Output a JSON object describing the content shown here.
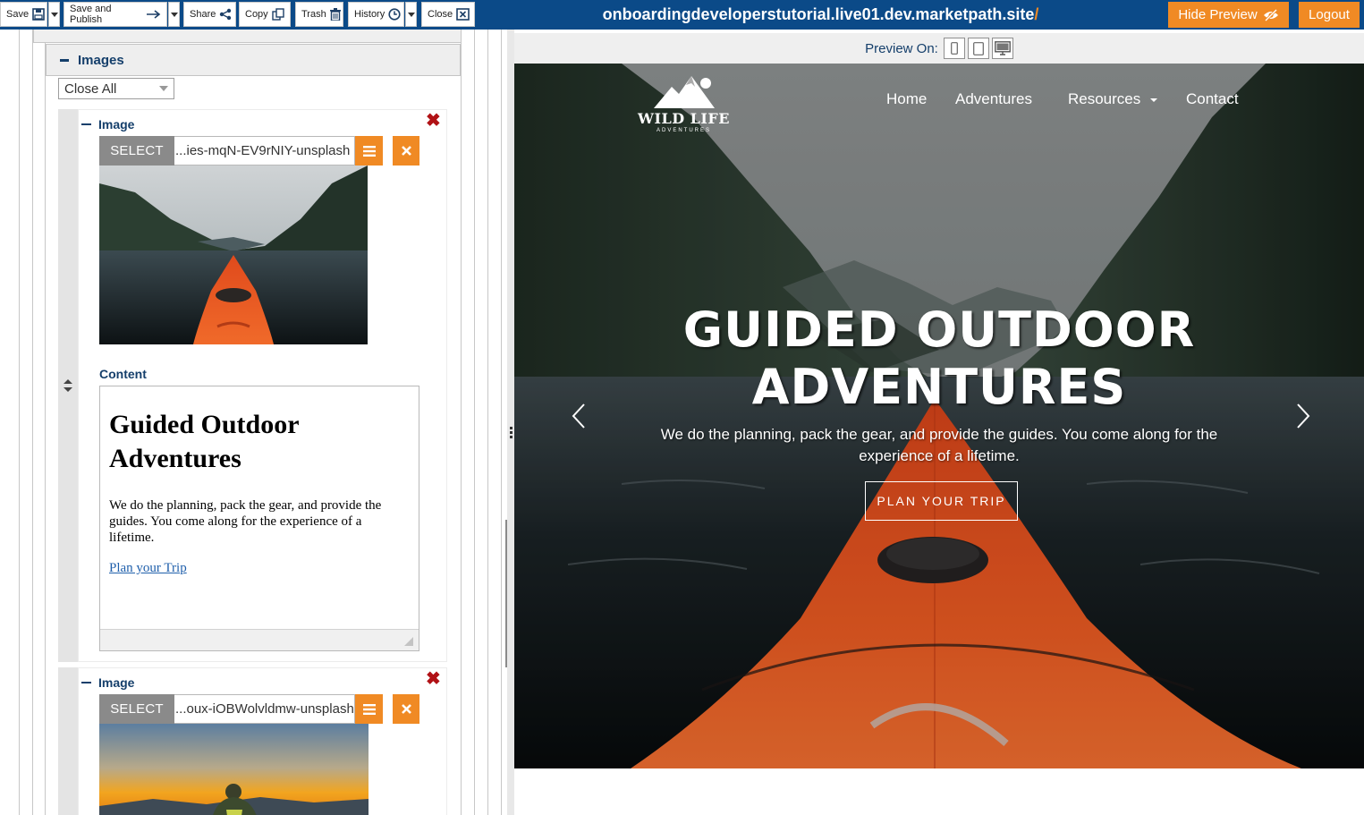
{
  "toolbar": {
    "save": "Save",
    "save_publish": "Save and Publish",
    "share": "Share",
    "copy": "Copy",
    "trash": "Trash",
    "history": "History",
    "close": "Close",
    "site_url": "onboardingdeveloperstutorial.live01.dev.marketpath.site",
    "site_url_slash": "/",
    "hide_preview": "Hide Preview",
    "logout": "Logout"
  },
  "editor": {
    "section_title": "Images",
    "close_all": "Close All",
    "items": [
      {
        "header": "Image",
        "select_label": "SELECT",
        "filename": "...ies-mqN-EV9rNIY-unsplash",
        "content_label": "Content",
        "content": {
          "heading": "Guided Outdoor Adventures",
          "paragraph": "We do the planning, pack the gear, and provide the guides. You come along for the experience of a lifetime.",
          "link": "Plan your Trip"
        }
      },
      {
        "header": "Image",
        "select_label": "SELECT",
        "filename": "...oux-iOBWolvldmw-unsplash"
      }
    ]
  },
  "preview": {
    "label": "Preview On:",
    "devices": [
      "phone-icon",
      "tablet-icon",
      "desktop-icon"
    ],
    "site": {
      "logo_title": "WILD LIFE",
      "logo_sub": "ADVENTURES",
      "nav": [
        "Home",
        "Adventures",
        "Resources",
        "Contact"
      ],
      "hero_title_1": "GUIDED OUTDOOR",
      "hero_title_2": "ADVENTURES",
      "hero_sub": "We do the planning, pack the gear, and provide the guides. You come along for the experience of a lifetime.",
      "cta": "PLAN YOUR TRIP"
    }
  },
  "colors": {
    "topbar": "#0b4a88",
    "accent_orange": "#f08a24",
    "label_navy": "#153f6b",
    "delete_red": "#b11216"
  }
}
